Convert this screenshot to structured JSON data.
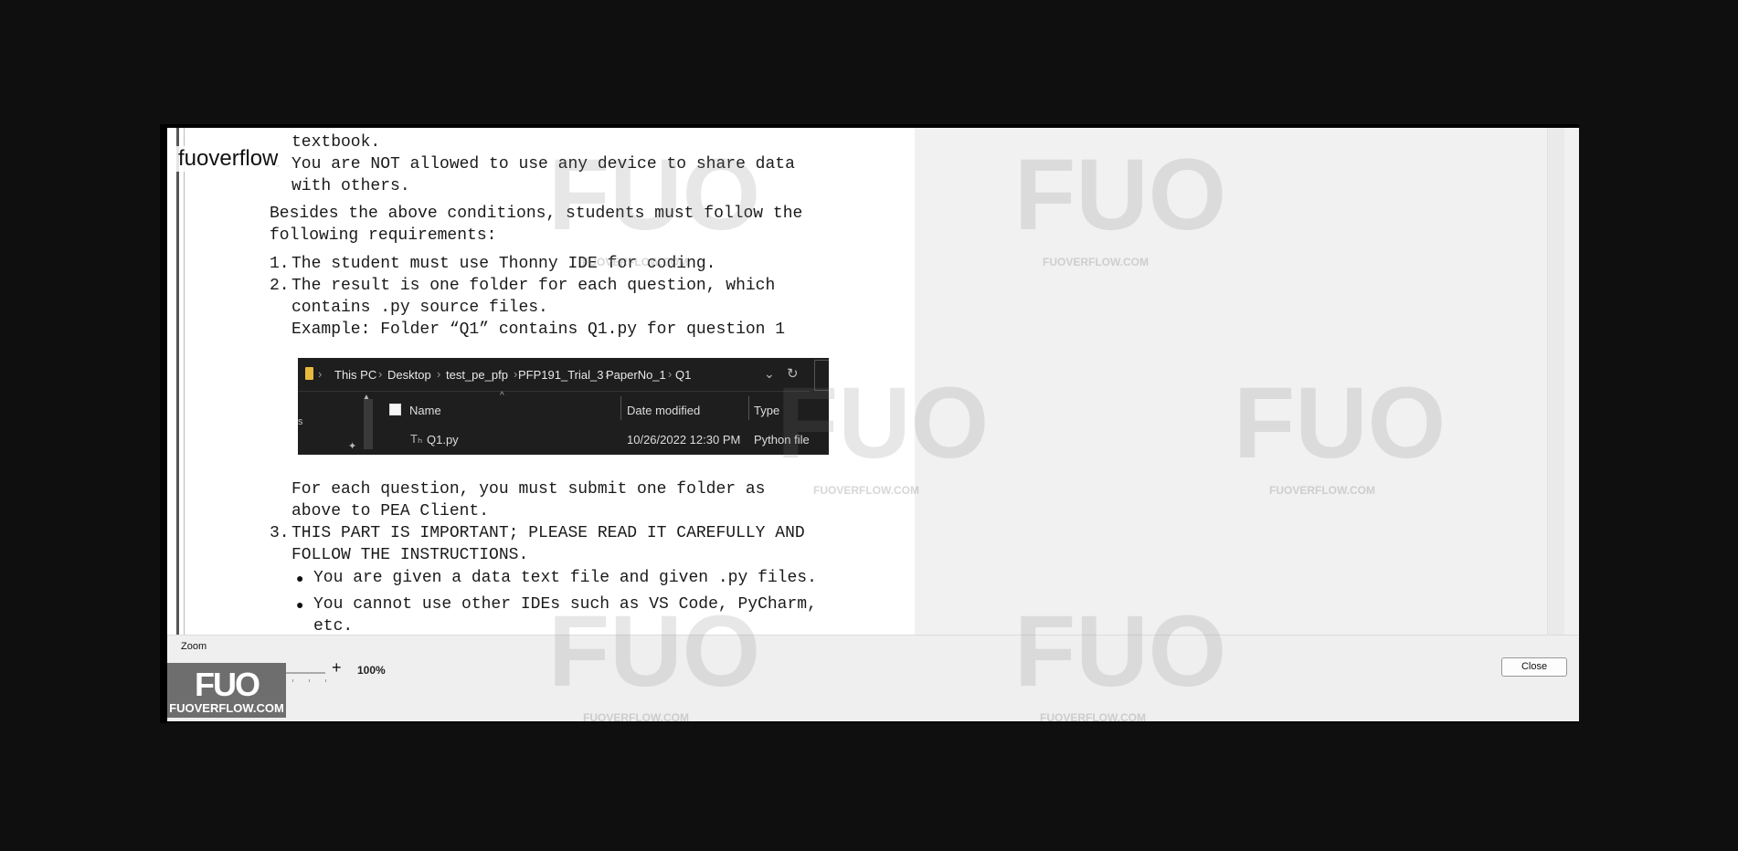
{
  "brand_text": "fuoverflow",
  "document": {
    "lines": [
      "textbook.",
      "You are NOT allowed to use any device to share data",
      "with others.",
      "Besides the above conditions, students must follow the",
      "following requirements:",
      "1.",
      "The student must use Thonny IDE for coding.",
      "2.",
      "The result is one folder for each question, which",
      "contains .py source files.",
      "Example: Folder “Q1” contains Q1.py for question 1",
      "For each question, you must submit one folder as",
      "above to PEA Client.",
      "3.",
      "THIS PART IS IMPORTANT; PLEASE READ IT CAREFULLY AND",
      "FOLLOW THE INSTRUCTIONS.",
      "You are given a data text file and given .py files.",
      "You cannot use other IDEs such as VS Code, PyCharm,",
      "etc."
    ],
    "dash": "-"
  },
  "explorer": {
    "breadcrumb": [
      "This PC",
      "Desktop",
      "test_pe_pfp",
      "PFP191_Trial_3",
      "PaperNo_1",
      "Q1"
    ],
    "columns": [
      "Name",
      "Date modified",
      "Type"
    ],
    "file": {
      "name": "Q1.py",
      "modified": "10/26/2022 12:30 PM",
      "type": "Python file"
    },
    "side_label": "s"
  },
  "zoom": {
    "label": "Zoom",
    "minus": "-",
    "plus": "+",
    "percent": "100%",
    "level_fraction": 0.5
  },
  "close_label": "Close",
  "logo": {
    "mark": "FUO",
    "text": "FUOVERFLOW.COM"
  },
  "watermark": {
    "mark": "FUO",
    "text": "FUOVERFLOW.COM"
  },
  "icons": {
    "folder": "folder-icon",
    "chevron": "chevron-down-icon",
    "refresh": "refresh-icon",
    "pin": "pin-icon",
    "python": "python-file-icon"
  }
}
